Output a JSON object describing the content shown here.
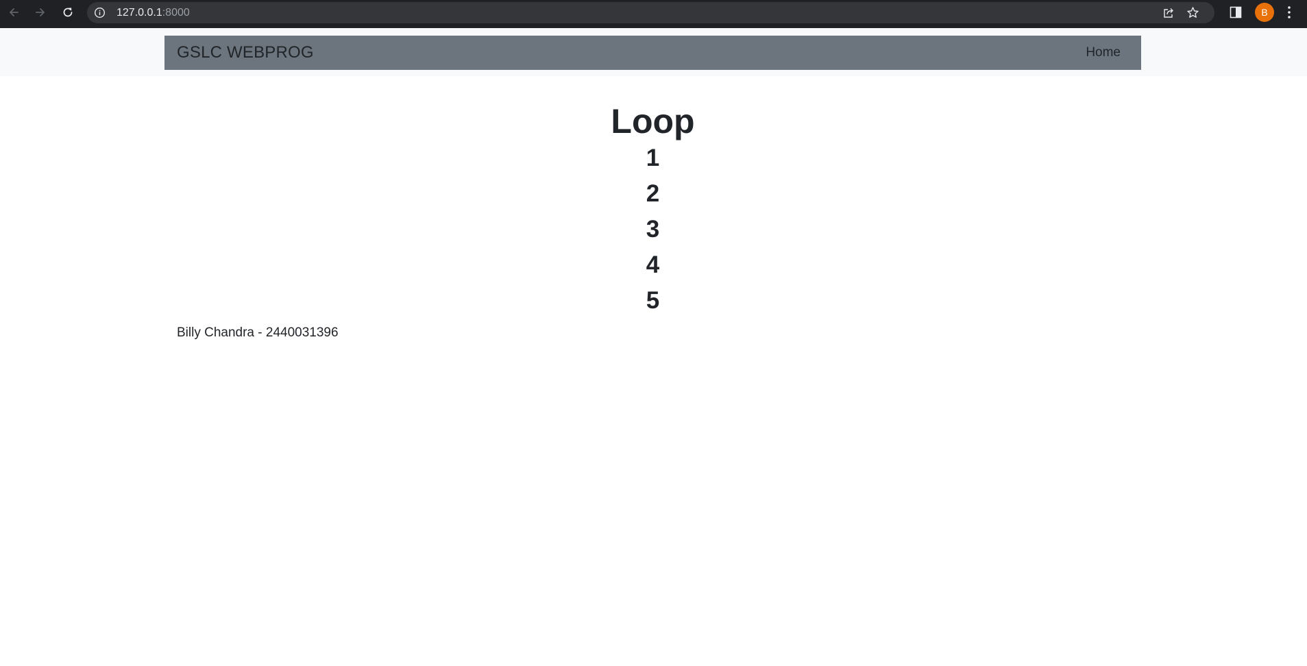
{
  "browser": {
    "url_host": "127.0.0.1",
    "url_port": ":8000",
    "profile_initial": "B",
    "profile_color": "#e8710a",
    "icons": [
      "back-arrow-icon",
      "forward-arrow-icon",
      "reload-icon",
      "info-icon",
      "share-icon",
      "star-icon",
      "side-panel-icon",
      "kebab-menu-icon"
    ]
  },
  "navbar": {
    "brand": "GSLC WEBPROG",
    "home_link": "Home",
    "background": "#6c757d"
  },
  "main": {
    "title": "Loop",
    "items": [
      "1",
      "2",
      "3",
      "4",
      "5"
    ]
  },
  "footer": {
    "text": "Billy Chandra - 2440031396"
  }
}
